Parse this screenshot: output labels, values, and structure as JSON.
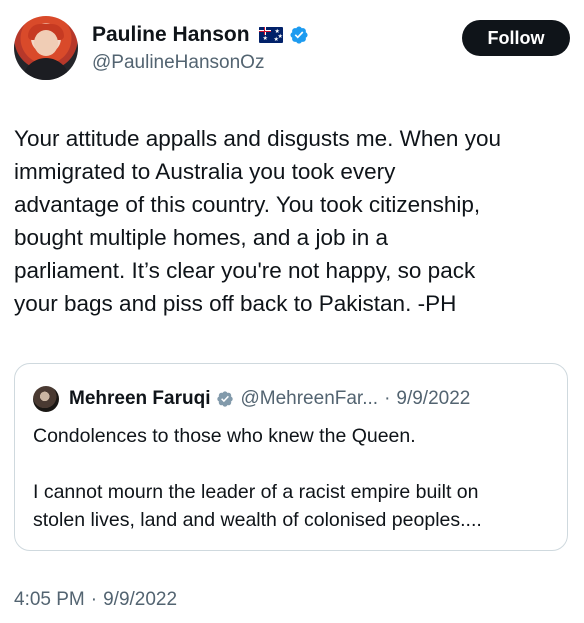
{
  "author": {
    "display_name": "Pauline Hanson",
    "handle": "@PaulineHansonOz",
    "flag_icon": "australia-flag-icon",
    "verified_icon": "verified-badge-icon"
  },
  "follow_label": "Follow",
  "tweet_text": "Your attitude appalls and disgusts me. When you\nimmigrated to Australia you took every\nadvantage of this country. You took citizenship,\nbought multiple homes, and a job in a\nparliament. It’s clear you're not happy, so pack\nyour bags and piss off back to Pakistan. -PH",
  "quote": {
    "display_name": "Mehreen Faruqi",
    "handle": "@MehreenFar...",
    "separator": "·",
    "date": "9/9/2022",
    "text": "Condolences to those who knew the Queen.\n\nI cannot mourn the leader of a racist empire built on\nstolen lives, land and wealth of colonised peoples...."
  },
  "meta": {
    "time": "4:05 PM",
    "separator": "·",
    "date": "9/9/2022"
  },
  "colors": {
    "verified_blue": "#1d9bf0",
    "verified_gray": "#829aab",
    "text_primary": "#0f1419",
    "text_secondary": "#536471",
    "border": "#cfd9de"
  }
}
